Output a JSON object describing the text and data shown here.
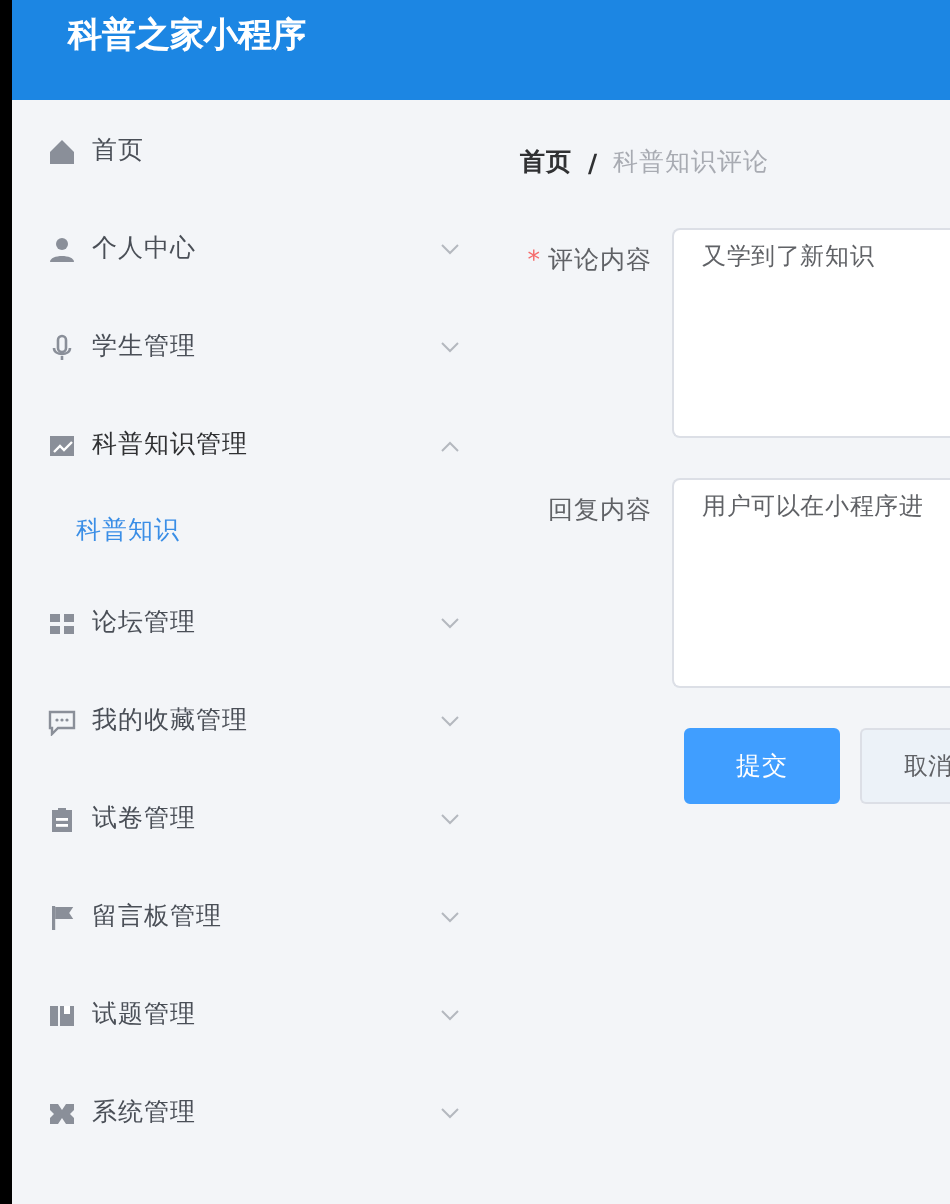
{
  "header": {
    "title": "科普之家小程序"
  },
  "sidebar": {
    "items": [
      {
        "label": "首页",
        "has_caret": false,
        "expanded": false,
        "selected": false
      },
      {
        "label": "个人中心",
        "has_caret": true,
        "expanded": false,
        "selected": false
      },
      {
        "label": "学生管理",
        "has_caret": true,
        "expanded": false,
        "selected": false
      },
      {
        "label": "科普知识管理",
        "has_caret": true,
        "expanded": true,
        "selected": false,
        "children": [
          {
            "label": "科普知识",
            "selected": true
          }
        ]
      },
      {
        "label": "论坛管理",
        "has_caret": true,
        "expanded": false,
        "selected": false
      },
      {
        "label": "我的收藏管理",
        "has_caret": true,
        "expanded": false,
        "selected": false
      },
      {
        "label": "试卷管理",
        "has_caret": true,
        "expanded": false,
        "selected": false
      },
      {
        "label": "留言板管理",
        "has_caret": true,
        "expanded": false,
        "selected": false
      },
      {
        "label": "试题管理",
        "has_caret": true,
        "expanded": false,
        "selected": false
      },
      {
        "label": "系统管理",
        "has_caret": true,
        "expanded": false,
        "selected": false
      }
    ]
  },
  "breadcrumb": [
    {
      "label": "首页",
      "current": false
    },
    {
      "label": "科普知识评论",
      "current": true
    }
  ],
  "separator": "/",
  "form": {
    "required_mark": "*",
    "fields": [
      {
        "label": "评论内容",
        "required": true,
        "value": "又学到了新知识"
      },
      {
        "label": "回复内容",
        "required": false,
        "value": "用户可以在小程序进"
      }
    ],
    "buttons": [
      {
        "label": "提交",
        "kind": "primary"
      },
      {
        "label": "取消",
        "kind": "default"
      }
    ]
  }
}
